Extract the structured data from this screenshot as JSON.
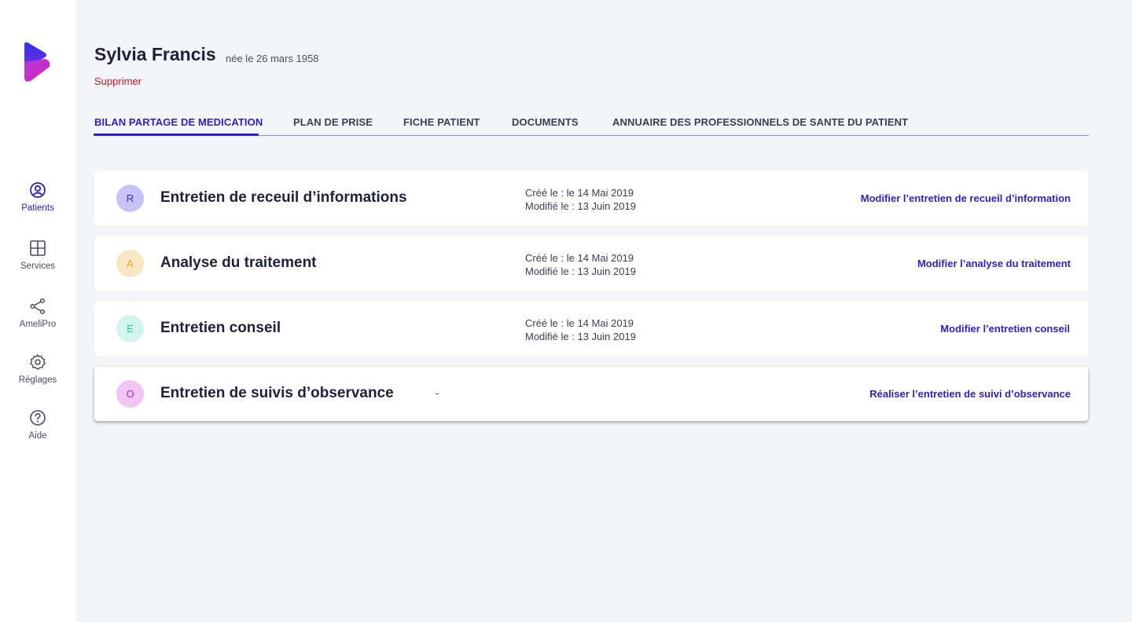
{
  "sidebar": {
    "items": [
      {
        "label": "Patients",
        "icon": "user-circle-icon",
        "active": true
      },
      {
        "label": "Services",
        "icon": "grid-icon",
        "active": false
      },
      {
        "label": "AmeliPro",
        "icon": "share-icon",
        "active": false
      },
      {
        "label": "Réglages",
        "icon": "gear-icon",
        "active": false
      },
      {
        "label": "Aide",
        "icon": "help-icon",
        "active": false
      }
    ]
  },
  "patient": {
    "name": "Sylvia Francis",
    "birth": "née le 26 mars 1958",
    "delete_label": "Supprimer"
  },
  "tabs": [
    {
      "label": "BILAN PARTAGE DE MEDICATION",
      "active": true
    },
    {
      "label": "PLAN DE PRISE",
      "active": false
    },
    {
      "label": "FICHE PATIENT",
      "active": false
    },
    {
      "label": "DOCUMENTS",
      "active": false
    },
    {
      "label": "ANNUAIRE DES PROFESSIONNELS DE SANTE DU PATIENT",
      "active": false
    }
  ],
  "cards": [
    {
      "initial": "R",
      "title": "Entretien de receuil d’informations",
      "created": "Créé le : le 14 Mai 2019",
      "modified": "Modifié le : 13 Juin 2019",
      "action": "Modifier l’entretien de recueil d’information",
      "avatar_bg": "#c8c3f7",
      "avatar_fg": "#3a2fa8"
    },
    {
      "initial": "A",
      "title": "Analyse du traitement",
      "created": "Créé le : le 14 Mai 2019",
      "modified": "Modifié le : 13 Juin 2019",
      "action": "Modifier l’analyse du traitement",
      "avatar_bg": "#fbe6c4",
      "avatar_fg": "#e3a13a"
    },
    {
      "initial": "E",
      "title": "Entretien conseil",
      "created": "Créé le : le 14 Mai 2019",
      "modified": "Modifié le : 13 Juin 2019",
      "action": "Modifier l’entretien conseil",
      "avatar_bg": "#d4f5ee",
      "avatar_fg": "#3fbf9f"
    },
    {
      "initial": "O",
      "title": "Entretien de suivis d’observance",
      "dash": "-",
      "action": "Réaliser l’entretien de suivi d’observance",
      "avatar_bg": "#f2c4f2",
      "avatar_fg": "#b02db8"
    }
  ],
  "colors": {
    "accent": "#2f1fc7",
    "danger": "#c6182d",
    "background": "#f4f5f9"
  }
}
